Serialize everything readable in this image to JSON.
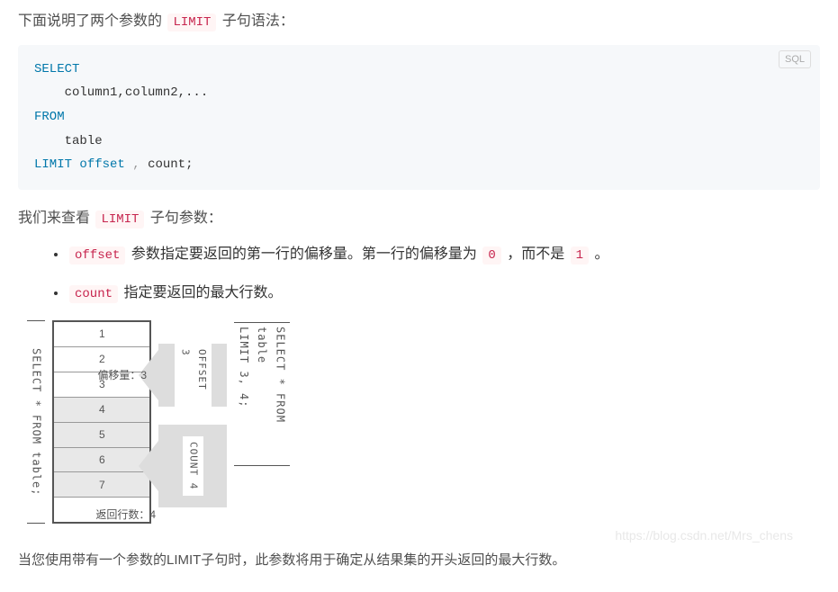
{
  "intro": {
    "prefix": "下面说明了两个参数的 ",
    "code": "LIMIT",
    "suffix": " 子句语法："
  },
  "codeblock": {
    "lang": "SQL",
    "kw_select": "SELECT",
    "line2": "    column1,column2,...",
    "kw_from": "FROM",
    "line4": "    table",
    "kw_limit": "LIMIT",
    "kw_offset": "offset",
    "punct": " , ",
    "count": "count;"
  },
  "para2": {
    "prefix": "我们来查看 ",
    "code": "LIMIT",
    "suffix": " 子句参数："
  },
  "bullets": [
    {
      "code": "offset",
      "text1": " 参数指定要返回的第一行的偏移量。第一行的偏移量为 ",
      "code2": "0",
      "text2": " ，而不是 ",
      "code3": "1",
      "text3": " 。"
    },
    {
      "code": "count",
      "text1": " 指定要返回的最大行数。"
    }
  ],
  "diagram": {
    "left_sql": "SELECT * FROM table;",
    "rows": [
      "1",
      "2",
      "3",
      "4",
      "5",
      "6",
      "7",
      "..."
    ],
    "highlight_start": 3,
    "highlight_end": 6,
    "arrow1_label": "OFFSET 3",
    "arrow1_cn": "偏移量：3",
    "arrow2_label": "COUNT 4",
    "arrow2_cn": "返回行数：4",
    "right_sql_l1": "SELECT * FROM table",
    "right_sql_l2": "LIMIT 3, 4;"
  },
  "footer": "当您使用带有一个参数的LIMIT子句时，此参数将用于确定从结果集的开头返回的最大行数。",
  "watermark": "https://blog.csdn.net/Mrs_chens"
}
